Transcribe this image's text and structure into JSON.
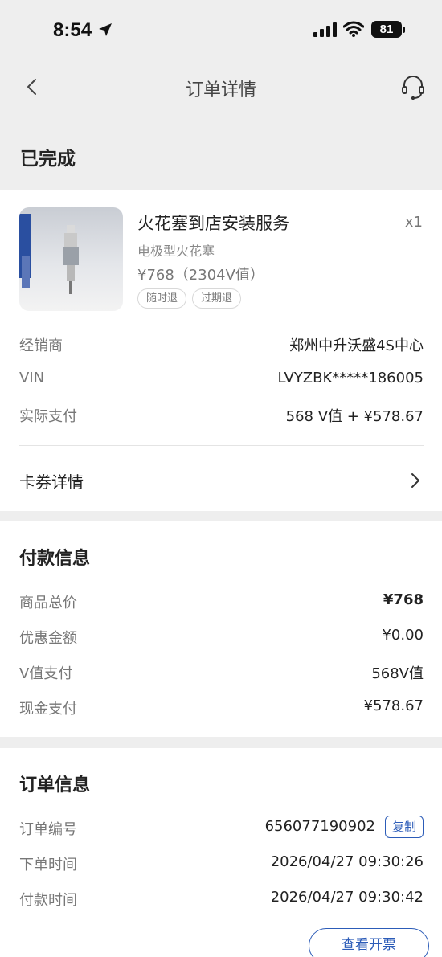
{
  "status_bar": {
    "time": "8:54",
    "battery": "81"
  },
  "nav": {
    "title": "订单详情"
  },
  "order": {
    "status": "已完成"
  },
  "product": {
    "name": "火花塞到店安装服务",
    "qty": "x1",
    "spec": "电极型火花塞",
    "price": "¥768（2304V值）",
    "tags": [
      "随时退",
      "过期退"
    ]
  },
  "details": [
    {
      "label": "经销商",
      "value": "郑州中升沃盛4S中心"
    },
    {
      "label": "VIN",
      "value": "LVYZBK*****186005"
    },
    {
      "label": "实际支付",
      "value": "568 V值 + ¥578.67"
    }
  ],
  "voucher": {
    "label": "卡券详情"
  },
  "payment": {
    "title": "付款信息",
    "rows": [
      {
        "label": "商品总价",
        "value": "¥768"
      },
      {
        "label": "优惠金额",
        "value": "¥0.00"
      },
      {
        "label": "V值支付",
        "value": "568V值"
      },
      {
        "label": "现金支付",
        "value": "¥578.67"
      }
    ]
  },
  "order_info": {
    "title": "订单信息",
    "rows": [
      {
        "label": "订单编号",
        "value": "656077190902"
      },
      {
        "label": "下单时间",
        "value": "2026/04/27 09:30:26"
      },
      {
        "label": "付款时间",
        "value": "2026/04/27 09:30:42"
      }
    ],
    "copy_label": "复制",
    "invoice_label": "查看开票"
  }
}
